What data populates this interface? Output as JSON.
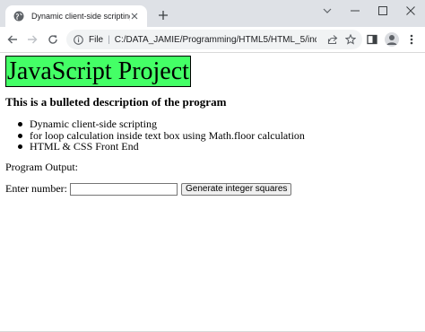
{
  "browser": {
    "tab_title": "Dynamic client-side scripting",
    "address_scheme_label": "File",
    "address_url": "C:/DATA_JAMIE/Programming/HTML5/HTML_5/index...."
  },
  "page": {
    "title": "JavaScript Project",
    "subtitle": "This is a bulleted description of the program",
    "bullets": [
      "Dynamic client-side scripting",
      "for loop calculation inside text box using Math.floor calculation",
      "HTML & CSS Front End"
    ],
    "output_label": "Program Output:",
    "enter_label": "Enter number:",
    "input_value": "",
    "button_label": "Generate integer squares"
  },
  "colors": {
    "heading_background": "#44ff66",
    "tab_strip": "#dee1e6",
    "omnibox": "#f1f3f4"
  }
}
